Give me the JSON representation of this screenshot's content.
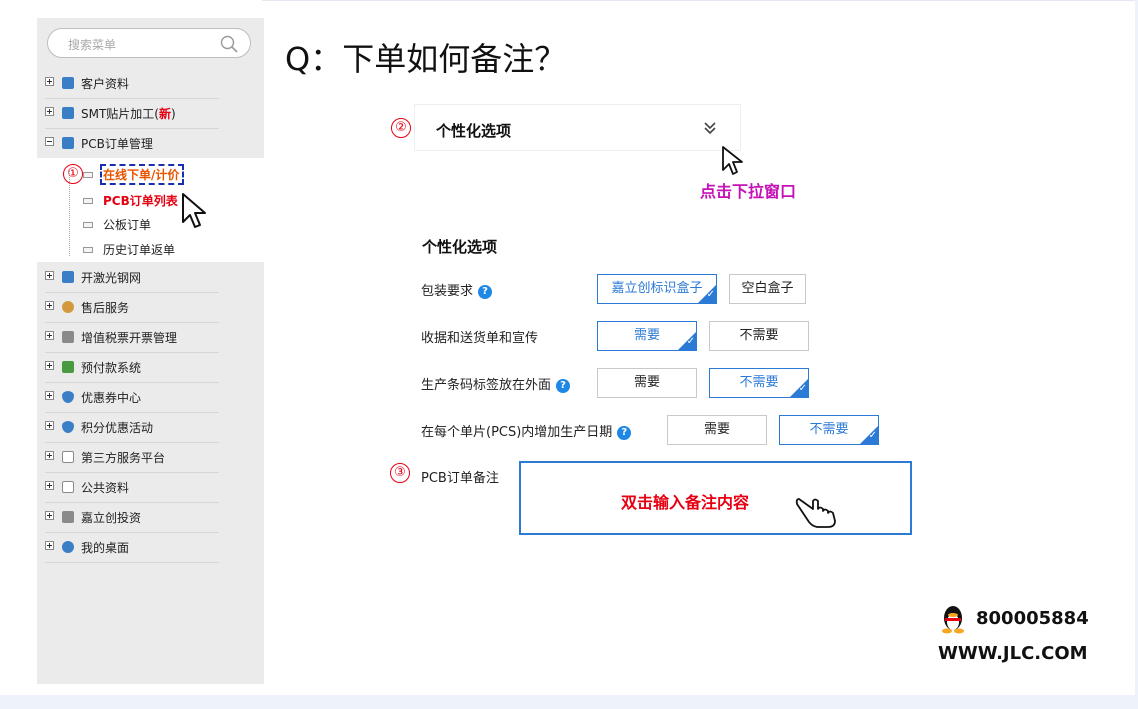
{
  "search": {
    "placeholder": "搜索菜单"
  },
  "sidebar": {
    "items": [
      {
        "label": "客户资料",
        "icon": "user-icon",
        "color": "#3a7fc6"
      },
      {
        "label": "SMT贴片加工(",
        "icon": "calc-icon",
        "color": "#3a7fc6",
        "tag": "新",
        "tag_suffix": ")"
      },
      {
        "label": "PCB订单管理",
        "icon": "calc-icon",
        "color": "#3a7fc6"
      },
      {
        "label": "开激光钢网",
        "icon": "calc-icon",
        "color": "#3a7fc6"
      },
      {
        "label": "售后服务",
        "icon": "person-icon",
        "color": "#d29a3c"
      },
      {
        "label": "增值税票开票管理",
        "icon": "doc-icon",
        "color": "#8a8a8a"
      },
      {
        "label": "预付款系统",
        "icon": "coins-icon",
        "color": "#4a9b3f"
      },
      {
        "label": "优惠券中心",
        "icon": "shield-icon",
        "color": "#3a7fc6"
      },
      {
        "label": "积分优惠活动",
        "icon": "shield-icon",
        "color": "#3a7fc6"
      },
      {
        "label": "第三方服务平台",
        "icon": "window-icon",
        "color": "#8a8a8a"
      },
      {
        "label": "公共资料",
        "icon": "window-icon",
        "color": "#8a8a8a"
      },
      {
        "label": "嘉立创投资",
        "icon": "doc-icon",
        "color": "#8a8a8a"
      },
      {
        "label": "我的桌面",
        "icon": "chat-icon",
        "color": "#3a7fc6"
      }
    ],
    "submenu": [
      {
        "label": "在线下单/计价"
      },
      {
        "label": "PCB订单列表"
      },
      {
        "label": "公板订单"
      },
      {
        "label": "历史订单返单"
      }
    ]
  },
  "steps": {
    "one": "①",
    "two": "②",
    "three": "③"
  },
  "main": {
    "title": "Q：下单如何备注？",
    "dropdown_label": "个性化选项",
    "dropdown_chevron": "≫",
    "hint": "点击下拉窗口",
    "section_title": "个性化选项",
    "rows": [
      {
        "label": "包装要求",
        "help": "?",
        "options": [
          "嘉立创标识盒子",
          "空白盒子"
        ],
        "selected": 0
      },
      {
        "label": "收据和送货单和宣传",
        "help": "",
        "options": [
          "需要",
          "不需要"
        ],
        "selected": 0
      },
      {
        "label": "生产条码标签放在外面",
        "help": "?",
        "options": [
          "需要",
          "不需要"
        ],
        "selected": 1
      },
      {
        "label": "在每个单片(PCS)内增加生产日期",
        "help": "?",
        "options": [
          "需要",
          "不需要"
        ],
        "selected": 1
      }
    ],
    "note_label": "PCB订单备注",
    "note_placeholder": "双击输入备注内容"
  },
  "contact": {
    "qq": "800005884",
    "site": "WWW.JLC.COM"
  },
  "colors": {
    "accent": "#2b7ad6",
    "red": "#e60012",
    "hint": "#c412b8"
  }
}
